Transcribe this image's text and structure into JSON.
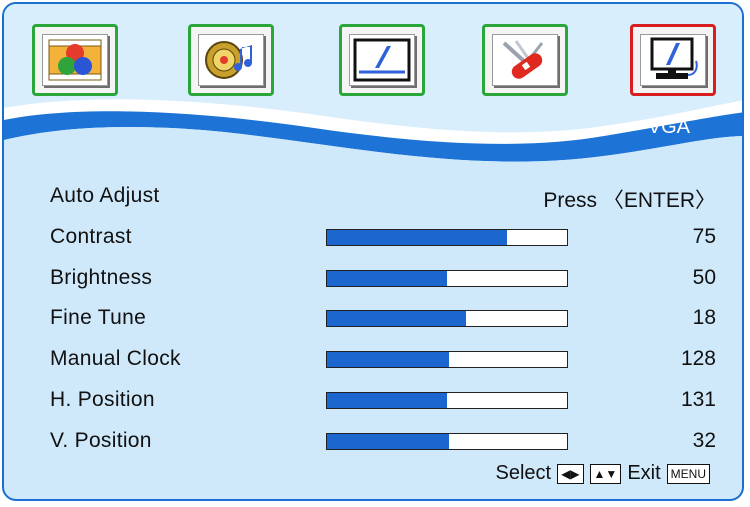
{
  "tabs": [
    {
      "name": "picture-tab",
      "icon": "color-balls-icon"
    },
    {
      "name": "audio-tab",
      "icon": "speaker-music-icon"
    },
    {
      "name": "screen-tab",
      "icon": "display-screen-icon"
    },
    {
      "name": "setup-tab",
      "icon": "swiss-knife-icon"
    },
    {
      "name": "vga-tab",
      "icon": "computer-monitor-icon",
      "active": true
    }
  ],
  "section_title": "VGA",
  "auto_adjust": {
    "label": "Auto Adjust",
    "action": "Press 〈ENTER〉"
  },
  "settings": [
    {
      "label": "Contrast",
      "value": "75",
      "fill": 0.75
    },
    {
      "label": "Brightness",
      "value": "50",
      "fill": 0.5
    },
    {
      "label": "Fine Tune",
      "value": "18",
      "fill": 0.58
    },
    {
      "label": "Manual Clock",
      "value": "128",
      "fill": 0.51
    },
    {
      "label": "H. Position",
      "value": "131",
      "fill": 0.5
    },
    {
      "label": "V. Position",
      "value": "32",
      "fill": 0.51
    }
  ],
  "footer": {
    "select_label": "Select",
    "exit_label": "Exit",
    "menu_key": "MENU"
  },
  "colors": {
    "accent": "#1b66cf",
    "frame": "#1a6fd0",
    "active_tab": "#d81e1e",
    "tab_border": "#2aa63a"
  }
}
